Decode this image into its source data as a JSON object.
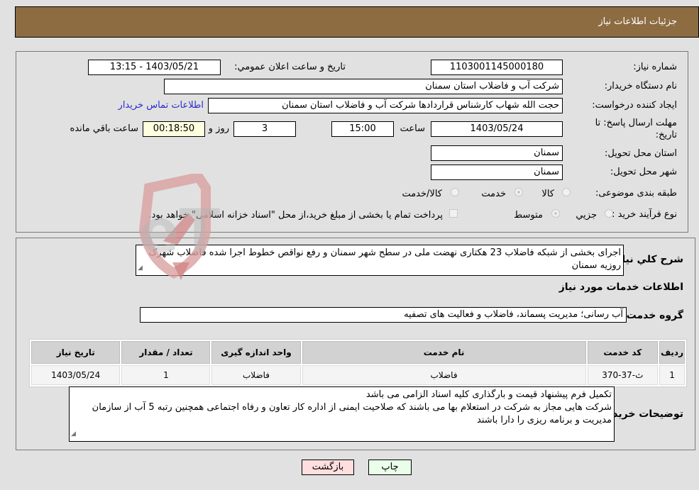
{
  "header": {
    "title": "جزئیات اطلاعات نیاز"
  },
  "details": {
    "need_number_label": "شماره نیاز:",
    "need_number": "1103001145000180",
    "announce_label": "تاریخ و ساعت اعلان عمومي:",
    "announce_value": "1403/05/21 - 13:15",
    "buyer_org_label": "نام دستگاه خریدار:",
    "buyer_org": "شرکت آب و فاضلاب استان سمنان",
    "creator_label": "ایجاد کننده درخواست:",
    "creator": "حجت الله شهاب کارشناس قراردادها شرکت آب و فاضلاب استان سمنان",
    "contact_link": "اطلاعات تماس خریدار",
    "deadline_label": "مهلت ارسال پاسخ: تا تاریخ:",
    "deadline_date": "1403/05/24",
    "time_label": "ساعت",
    "deadline_time": "15:00",
    "days_value": "3",
    "days_label": "روز و",
    "remaining_time": "00:18:50",
    "remaining_label": "ساعت باقي مانده",
    "province_label": "استان محل تحویل:",
    "province": "سمنان",
    "city_label": "شهر محل تحویل:",
    "city": "سمنان",
    "category_label": "طبقه بندی موضوعی:",
    "category_options": [
      "کالا",
      "خدمت",
      "کالا/خدمت"
    ],
    "category_selected": "خدمت",
    "process_label": "نوع فرآیند خرید :",
    "process_options": [
      "جزیي",
      "متوسط"
    ],
    "process_selected": "متوسط",
    "treasury_note": "پرداخت تمام یا بخشی از مبلغ خرید،از محل \"اسناد خزانه اسلامی\" خواهد بود."
  },
  "description": {
    "label": "شرح کلي نیاز:",
    "text": "اجرای بخشی از شبکه فاضلاب 23 هکتاری نهضت ملی در سطح شهر سمنان و رفع نواقص خطوط اجرا شده فاضلاب شهرک روزیه سمنان"
  },
  "services": {
    "section_title": "اطلاعات خدمات مورد نیاز",
    "group_label": "گروه خدمت:",
    "group_value": "آب رسانی؛ مدیریت پسماند، فاضلاب و فعالیت های تصفیه",
    "columns": [
      "ردیف",
      "کد خدمت",
      "نام خدمت",
      "واحد اندازه گیری",
      "تعداد / مقدار",
      "تاریخ نیاز"
    ],
    "rows": [
      [
        "1",
        "ث-37-370",
        "فاضلاب",
        "فاضلاب",
        "1",
        "1403/05/24"
      ]
    ]
  },
  "buyer_notes": {
    "label": "توضیحات خریدار:",
    "lines": [
      "تکمیل فرم پیشنهاد قیمت و بارگذاری کلیه اسناد الزامی می باشد",
      "شرکت هایی مجاز به شرکت در استعلام بها می باشند که صلاحیت ایمنی از اداره کار تعاون و رفاه اجتماعی همچنین رتبه 5 آب از سازمان مدیریت و برنامه ریزی را دارا باشند"
    ]
  },
  "buttons": {
    "print": "چاپ",
    "back": "بازگشت"
  },
  "watermark": {
    "text": "AriaTender.neT"
  },
  "colors": {
    "header_bg": "#8d6c42",
    "link": "#2a2ad0",
    "print_bg": "#eaffea",
    "back_bg": "#ffdede"
  }
}
